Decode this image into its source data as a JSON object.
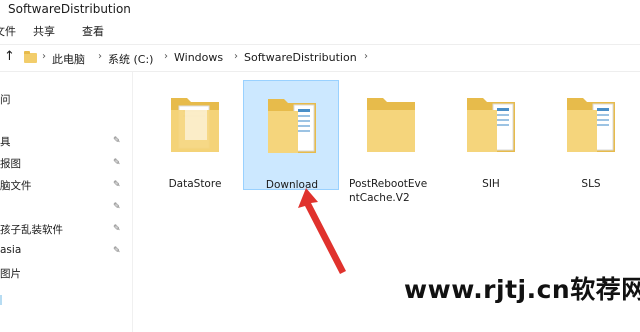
{
  "window": {
    "title": "SoftwareDistribution"
  },
  "ribbon": {
    "tabs": [
      "文件",
      "共享",
      "查看"
    ]
  },
  "address": {
    "up_icon": "arrow-up-icon",
    "crumbs": [
      "此电脑",
      "系统 (C:)",
      "Windows",
      "SoftwareDistribution"
    ]
  },
  "sidebar": {
    "items": [
      {
        "label": "问",
        "pinned": false
      },
      {
        "label": "具",
        "pinned": true
      },
      {
        "label": "报图",
        "pinned": true
      },
      {
        "label": "脑文件",
        "pinned": true
      },
      {
        "label": "",
        "pinned": true
      },
      {
        "label": "孩子乱装软件",
        "pinned": true
      },
      {
        "label": "asia",
        "pinned": true
      },
      {
        "label": "图片",
        "pinned": false
      }
    ]
  },
  "folders": [
    {
      "name": "DataStore",
      "selected": false
    },
    {
      "name": "Download",
      "selected": true
    },
    {
      "name": "PostRebootEve ntCache.V2",
      "selected": false
    },
    {
      "name": "SIH",
      "selected": false
    },
    {
      "name": "SLS",
      "selected": false
    }
  ],
  "watermark": {
    "text": "www.rjtj.cn软荐网"
  },
  "colors": {
    "selection": "#cce8ff",
    "folder": "#f2cd6b",
    "arrow": "#e0322d"
  }
}
